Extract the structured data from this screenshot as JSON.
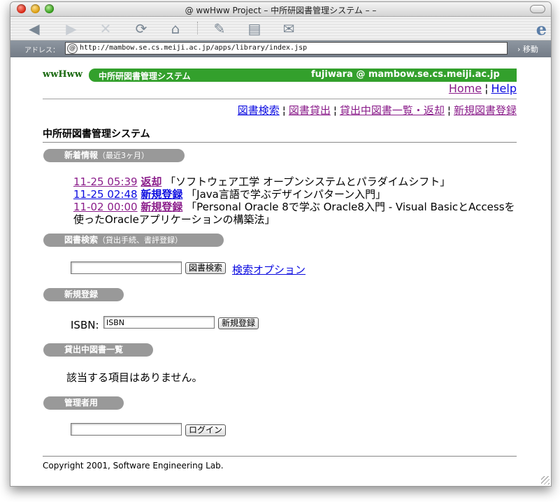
{
  "window": {
    "title": "@ wwHww Project – 中所研図書管理システム  –  –"
  },
  "toolbar": {
    "icons": [
      "back-icon",
      "forward-icon",
      "stop-icon",
      "refresh-icon",
      "home-icon",
      "autofill-icon",
      "print-icon",
      "mail-icon"
    ],
    "ie_logo": "e"
  },
  "address": {
    "label": "アドレス：",
    "at": "@",
    "url": "http://mambow.se.cs.meiji.ac.jp/apps/library/index.jsp",
    "go": "› 移動"
  },
  "header": {
    "brand": "wwHww",
    "system_name": "中所研図書管理システム",
    "user": "fujiwara @ mambow.se.cs.meiji.ac.jp",
    "home": "Home",
    "help": "Help",
    "sep": "¦"
  },
  "nav": {
    "items": [
      "図書検索",
      "図書貸出",
      "貸出中図書一覧・返却",
      "新規図書登録"
    ]
  },
  "page_title": "中所研図書管理システム",
  "sections": {
    "news": {
      "label": "新着情報",
      "sub": "（最近3ヶ月）"
    },
    "search": {
      "label": "図書検索",
      "sub": "（貸出手続、書評登録）"
    },
    "register": {
      "label": "新規登録"
    },
    "lending": {
      "label": "貸出中図書一覧"
    },
    "admin": {
      "label": "管理者用"
    }
  },
  "news": [
    {
      "time": "11-25 05:39",
      "tag": "返却",
      "title": "「ソフトウェア工学 オープンシステムとパラダイムシフト」"
    },
    {
      "time": "11-25 02:48",
      "tag": "新規登録",
      "title": "「Java言語で学ぶデザインパターン入門」"
    },
    {
      "time": "11-02 00:00",
      "tag": "新規登録",
      "title": "「Personal Oracle 8で学ぶ Oracle8入門 - Visual BasicとAccessを使ったOracleアプリケーションの構築法」"
    }
  ],
  "search_form": {
    "value": "",
    "button": "図書検索",
    "options_link": "検索オプション"
  },
  "register_form": {
    "label": "ISBN:",
    "value": "ISBN",
    "button": "新規登録"
  },
  "lending": {
    "empty": "該当する項目はありません。"
  },
  "admin_form": {
    "value": "",
    "button": "ログイン"
  },
  "footer": {
    "copyright": "Copyright 2001, Software Engineering Lab."
  }
}
